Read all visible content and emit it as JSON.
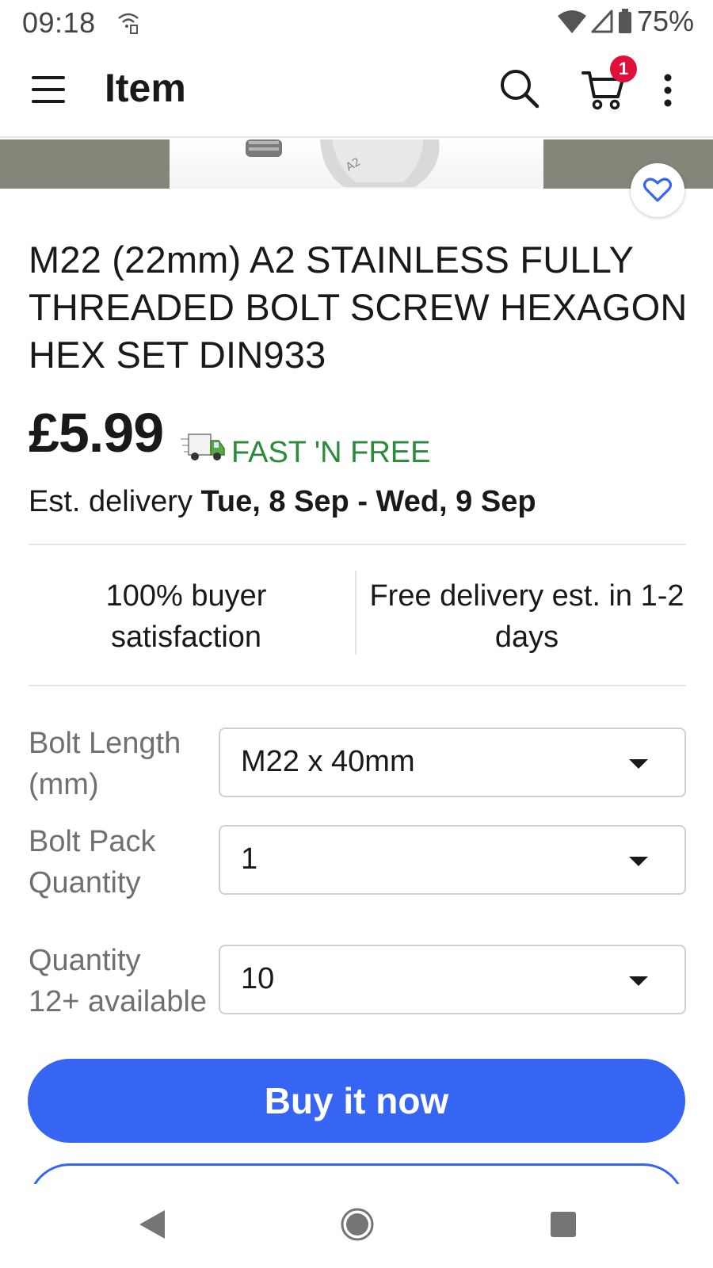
{
  "status_bar": {
    "time": "09:18",
    "battery_percent": "75%",
    "icons": [
      "wifi-hotspot-icon",
      "wifi-icon",
      "signal-icon",
      "battery-icon"
    ]
  },
  "app_bar": {
    "title": "Item",
    "cart_count": "1",
    "icons": [
      "menu-icon",
      "search-icon",
      "cart-icon",
      "more-vert-icon"
    ]
  },
  "item": {
    "title": "M22 (22mm) A2 STAINLESS FULLY THREADED BOLT SCREW HEXAGON HEX SET DIN933",
    "price": "£5.99",
    "shipping_label": "FAST 'N FREE",
    "est_delivery_prefix": "Est. delivery ",
    "est_delivery_dates": "Tue, 8 Sep - Wed, 9 Sep"
  },
  "trust": {
    "left": "100% buyer satisfaction",
    "right": "Free delivery est. in 1-2 days"
  },
  "options": {
    "bolt_length": {
      "label": "Bolt Length (mm)",
      "value": "M22 x 40mm"
    },
    "pack_quantity": {
      "label": "Bolt Pack Quantity",
      "value": "1"
    },
    "quantity": {
      "label": "Quantity",
      "available": "12+ available",
      "value": "10"
    }
  },
  "actions": {
    "buy_now": "Buy it now"
  },
  "colors": {
    "accent": "#3665f3",
    "shipping_green": "#2b8a3e",
    "badge_red": "#e0103a"
  }
}
